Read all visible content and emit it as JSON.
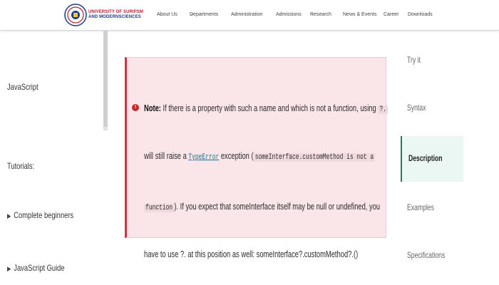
{
  "header": {
    "brand_line1": "UNIVERSITY OF SURIPSM",
    "brand_line2": "AND MODERNSCIENCES",
    "nav": [
      {
        "label": "About Us",
        "dropdown": true
      },
      {
        "label": "Departments",
        "dropdown": true
      },
      {
        "label": "Administration",
        "dropdown": true
      },
      {
        "label": "Admissions",
        "dropdown": false
      },
      {
        "label": "Research",
        "dropdown": true
      },
      {
        "label": "News & Events",
        "dropdown": false
      },
      {
        "label": "Career",
        "dropdown": false
      },
      {
        "label": "Downloads",
        "dropdown": false
      }
    ]
  },
  "sidebar": {
    "title": "JavaScript",
    "tutorials": "Tutorials:",
    "items": [
      "Complete beginners",
      "JavaScript Guide"
    ]
  },
  "note": {
    "label": "Note:",
    "line1_text": "If there is a property with such a name and which is not a function, using",
    "line1_end": "?.",
    "line2_a": "will still raise a",
    "line2_link": "TypeError",
    "line2_b": "exception (",
    "line2_code": "someInterface.customMethod is not a",
    "line3_code": "function",
    "line3_text": "). If you expect that someInterface itself may be null or undefined, you",
    "line4_text": "have to use ?. at this position as well: someInterface?.customMethod?.()"
  },
  "toc": {
    "items": [
      "Try it",
      "Syntax",
      "Description",
      "Examples",
      "Specifications"
    ],
    "active_index": 2
  },
  "colors": {
    "note_bg": "#fae5e8",
    "note_border": "#d32f3f",
    "toc_active": "#1a7f5a",
    "brand_red": "#b5202e",
    "brand_blue": "#1e3a8a"
  }
}
